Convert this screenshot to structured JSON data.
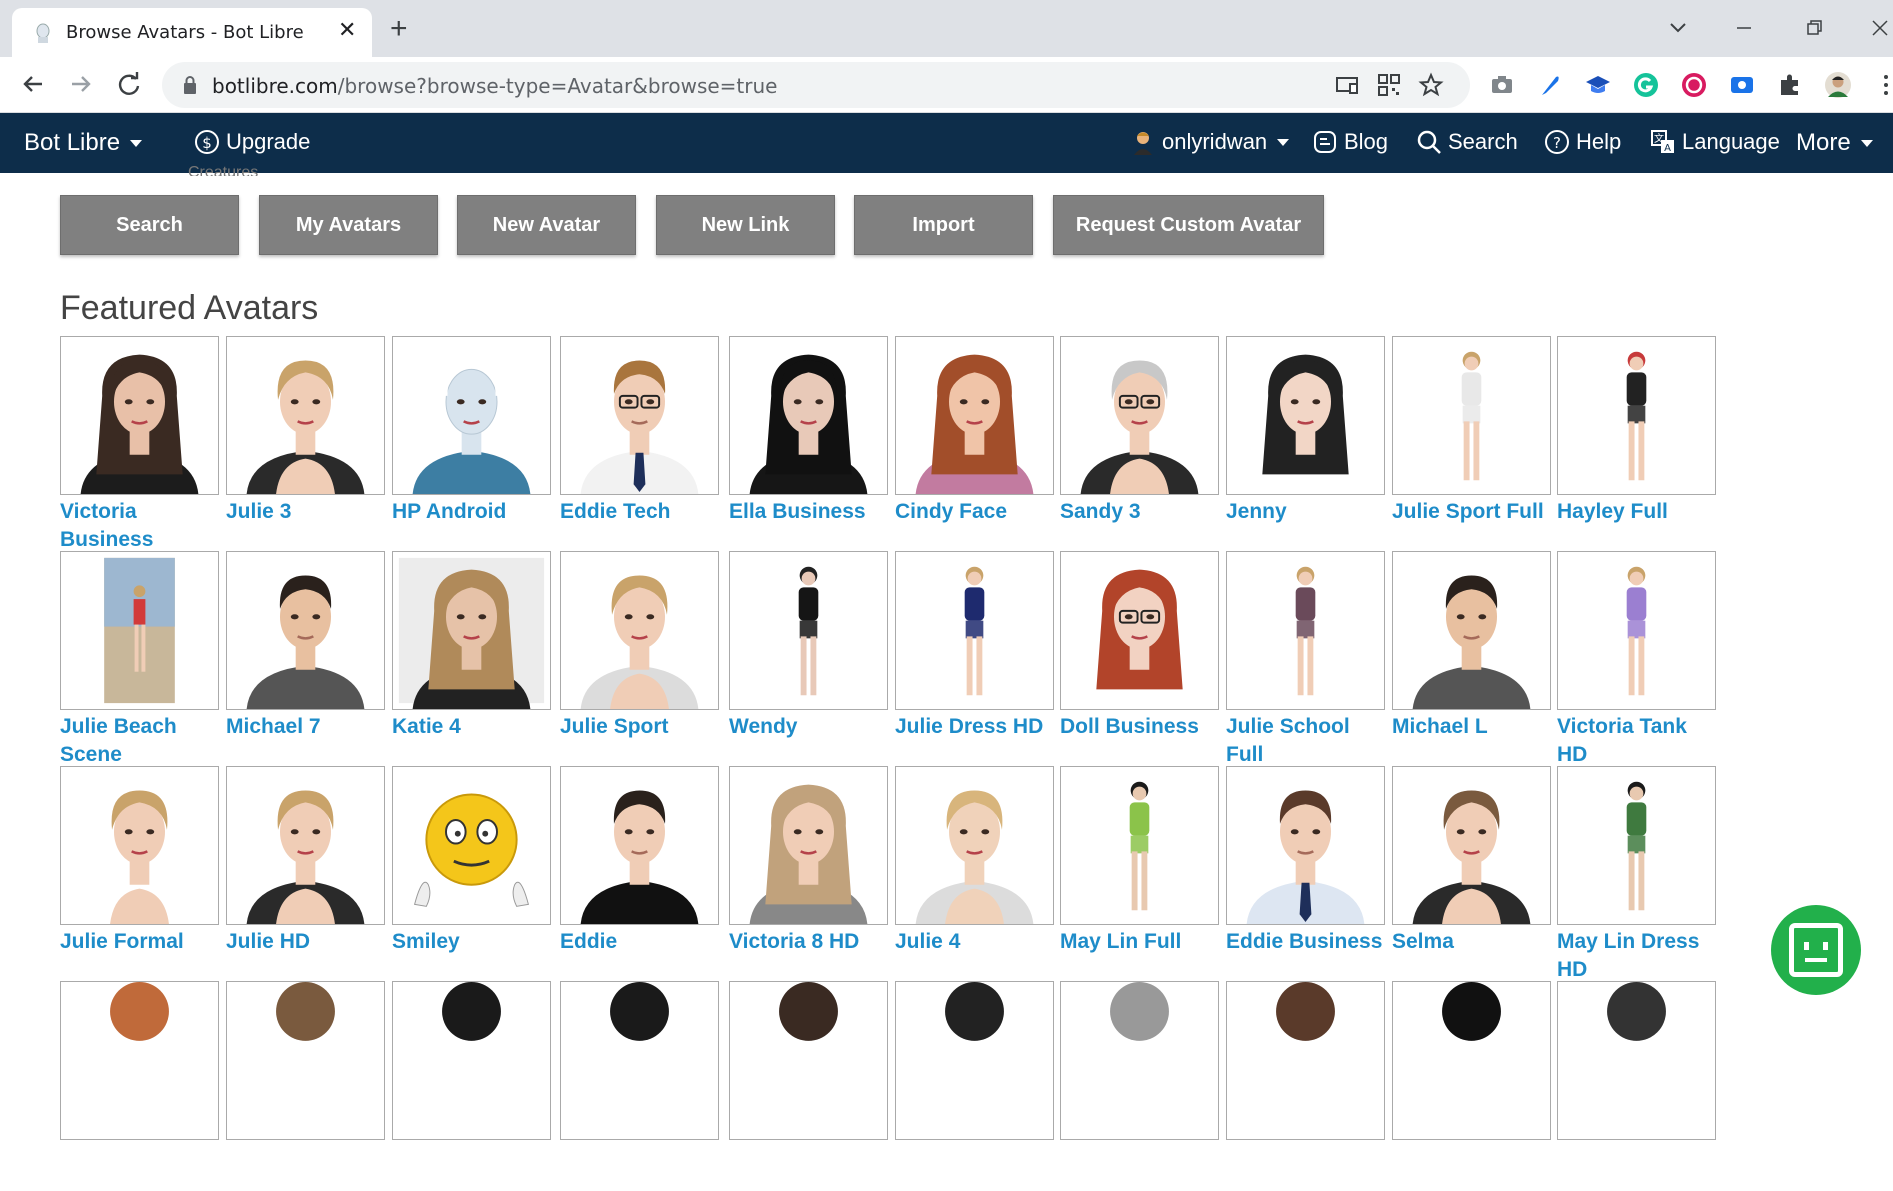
{
  "browser": {
    "tab_title": "Browse Avatars - Bot Libre",
    "tab_close": "✕",
    "new_tab": "+",
    "url_host": "botlibre.com",
    "url_path": "/browse?browse-type=Avatar&browse=true"
  },
  "site_nav": {
    "brand": "Bot Libre",
    "upgrade": "Upgrade",
    "user": "onlyridwan",
    "blog": "Blog",
    "search": "Search",
    "help": "Help",
    "language": "Language",
    "more": "More"
  },
  "peek_text": "Creatures",
  "actions": {
    "search": "Search",
    "my_avatars": "My Avatars",
    "new_avatar": "New Avatar",
    "new_link": "New Link",
    "import": "Import",
    "request_custom": "Request Custom Avatar"
  },
  "section_title": "Featured Avatars",
  "avatars": [
    {
      "name": "Victoria Business",
      "kind": "woman",
      "hair": "#3a2a22",
      "skin": "#e8c0a8",
      "top": "#1c1c1c"
    },
    {
      "name": "Julie 3",
      "kind": "woman-short",
      "hair": "#c9a36a",
      "skin": "#f0cdb6",
      "top": "#2a2a2a"
    },
    {
      "name": "HP Android",
      "kind": "robot",
      "hair": "#d8e4ee",
      "skin": "#d8e4ee",
      "top": "#3d7ea3"
    },
    {
      "name": "Eddie Tech",
      "kind": "man-glasses",
      "hair": "#a9753d",
      "skin": "#f0cdb6",
      "top": "#f2f2f2"
    },
    {
      "name": "Ella Business",
      "kind": "woman",
      "hair": "#111111",
      "skin": "#e8c9b8",
      "top": "#161616"
    },
    {
      "name": "Cindy Face",
      "kind": "woman",
      "hair": "#a24e2a",
      "skin": "#f0c4a8",
      "top": "#c27ba0"
    },
    {
      "name": "Sandy 3",
      "kind": "woman-short-glasses",
      "hair": "#c8c8c8",
      "skin": "#f0cdb6",
      "top": "#2a2a2a"
    },
    {
      "name": "Jenny",
      "kind": "woman",
      "hair": "#222222",
      "skin": "#f2d6c6",
      "top": "#ffffff"
    },
    {
      "name": "Julie Sport Full",
      "kind": "full",
      "hair": "#c9a36a",
      "skin": "#f0cdb6",
      "top": "#e8e8e8"
    },
    {
      "name": "Hayley Full",
      "kind": "full",
      "hair": "#c73a3a",
      "skin": "#f0cdb6",
      "top": "#222222"
    },
    {
      "name": "Julie Beach Scene",
      "kind": "beach",
      "hair": "#c9a36a",
      "skin": "#f0cdb6",
      "top": "#d23a3a"
    },
    {
      "name": "Michael 7",
      "kind": "man",
      "hair": "#2a211c",
      "skin": "#e8c0a0",
      "top": "#555555"
    },
    {
      "name": "Katie 4",
      "kind": "woman-photo",
      "hair": "#b08a5a",
      "skin": "#e6c2a8",
      "top": "#222222"
    },
    {
      "name": "Julie Sport",
      "kind": "woman-short",
      "hair": "#c9a36a",
      "skin": "#f0cdb6",
      "top": "#dcdcdc"
    },
    {
      "name": "Wendy",
      "kind": "full",
      "hair": "#222222",
      "skin": "#e8c9b8",
      "top": "#151515"
    },
    {
      "name": "Julie Dress HD",
      "kind": "full",
      "hair": "#c9a36a",
      "skin": "#f0cdb6",
      "top": "#1e2a6e"
    },
    {
      "name": "Doll Business",
      "kind": "woman-glasses",
      "hair": "#b2442a",
      "skin": "#f2d2c2",
      "top": "#ffffff"
    },
    {
      "name": "Julie School Full",
      "kind": "full",
      "hair": "#c9a36a",
      "skin": "#f0cdb6",
      "top": "#6a4a5a"
    },
    {
      "name": "Michael L",
      "kind": "man",
      "hair": "#2a211c",
      "skin": "#e8c0a0",
      "top": "#555555"
    },
    {
      "name": "Victoria Tank HD",
      "kind": "full",
      "hair": "#c9a36a",
      "skin": "#f0cdb6",
      "top": "#9b7fd1"
    },
    {
      "name": "Julie Formal",
      "kind": "woman-short",
      "hair": "#c9a36a",
      "skin": "#f0cdb6",
      "top": "#ffffff"
    },
    {
      "name": "Julie HD",
      "kind": "woman-short",
      "hair": "#c9a36a",
      "skin": "#f0cdb6",
      "top": "#2a2a2a"
    },
    {
      "name": "Smiley",
      "kind": "smiley",
      "hair": "#f4c61a",
      "skin": "#f4c61a",
      "top": "#ffffff"
    },
    {
      "name": "Eddie",
      "kind": "man",
      "hair": "#2a211c",
      "skin": "#f0cdb6",
      "top": "#111111"
    },
    {
      "name": "Victoria 8 HD",
      "kind": "woman",
      "hair": "#c1a27c",
      "skin": "#f0cdb6",
      "top": "#888888"
    },
    {
      "name": "Julie 4",
      "kind": "woman-short",
      "hair": "#d8b57c",
      "skin": "#f0d2ba",
      "top": "#dcdcdc"
    },
    {
      "name": "May Lin Full",
      "kind": "full",
      "hair": "#1a1a1a",
      "skin": "#e8c9b0",
      "top": "#8bc34a"
    },
    {
      "name": "Eddie Business",
      "kind": "man-tie",
      "hair": "#5a3a2a",
      "skin": "#f0cdb6",
      "top": "#dde6f2"
    },
    {
      "name": "Selma",
      "kind": "woman-short",
      "hair": "#7a5a3e",
      "skin": "#f0cdb6",
      "top": "#2a2a2a"
    },
    {
      "name": "May Lin Dress HD",
      "kind": "full",
      "hair": "#1a1a1a",
      "skin": "#e8c9b0",
      "top": "#3f7a3f"
    },
    {
      "name": "",
      "kind": "partial",
      "hair": "#c06a3a",
      "skin": "#f0cdb6",
      "top": "#ffffff"
    },
    {
      "name": "",
      "kind": "partial",
      "hair": "#7a5a3e",
      "skin": "#f0cdb6",
      "top": "#ffffff"
    },
    {
      "name": "",
      "kind": "partial",
      "hair": "#1a1a1a",
      "skin": "#f0cdb6",
      "top": "#ffffff"
    },
    {
      "name": "",
      "kind": "partial",
      "hair": "#1a1a1a",
      "skin": "#f0cdb6",
      "top": "#ffffff"
    },
    {
      "name": "",
      "kind": "partial",
      "hair": "#3a2a22",
      "skin": "#f0cdb6",
      "top": "#ffffff"
    },
    {
      "name": "",
      "kind": "partial",
      "hair": "#222222",
      "skin": "#f0cdb6",
      "top": "#ffffff"
    },
    {
      "name": "",
      "kind": "partial",
      "hair": "#999999",
      "skin": "#f0cdb6",
      "top": "#ffffff"
    },
    {
      "name": "",
      "kind": "partial",
      "hair": "#5a3a2a",
      "skin": "#f0cdb6",
      "top": "#ffffff"
    },
    {
      "name": "",
      "kind": "partial",
      "hair": "#111111",
      "skin": "#f0cdb6",
      "top": "#ffffff"
    },
    {
      "name": "",
      "kind": "partial",
      "hair": "#333333",
      "skin": "#f0cdb6",
      "top": "#ffffff"
    }
  ],
  "colors": {
    "nav_bg": "#0d2d4a",
    "button_bg": "#808080",
    "link": "#1e8cc9",
    "chat_fab": "#22b04b"
  }
}
